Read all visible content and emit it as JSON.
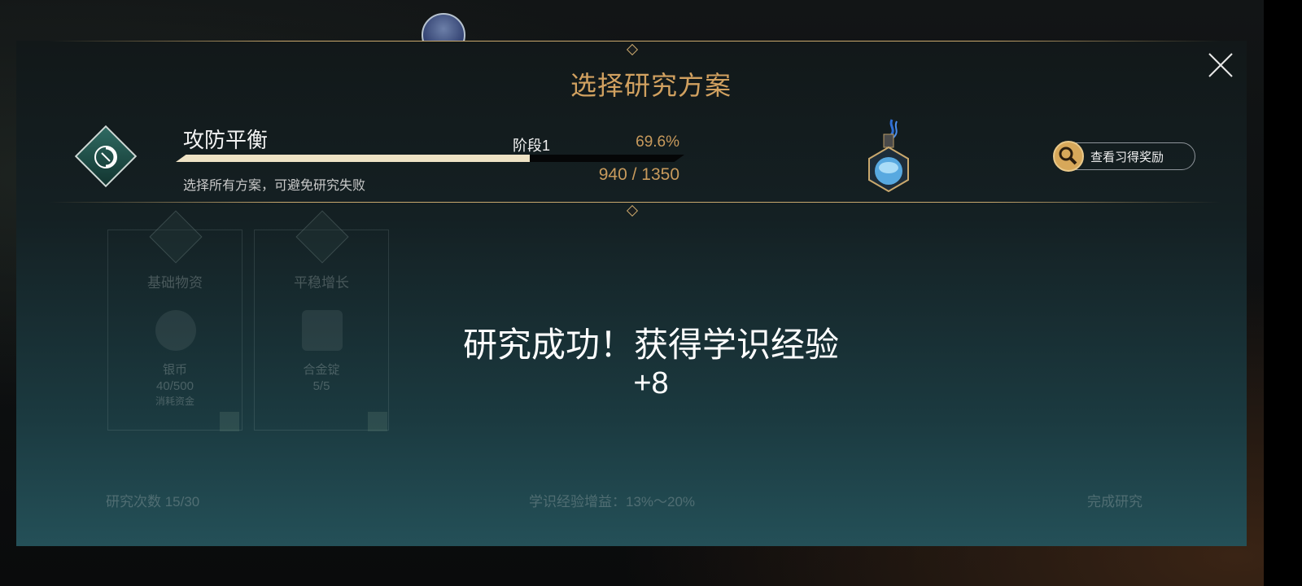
{
  "dialog": {
    "title": "选择研究方案"
  },
  "plan": {
    "name": "攻防平衡",
    "hint": "选择所有方案，可避免研究失败",
    "stage": "阶段1",
    "percent_text": "69.6%",
    "progress": 0.696,
    "xp_text": "940 / 1350"
  },
  "reward_button": {
    "label": "查看习得奖励",
    "icon": "magnifier-icon"
  },
  "options": [
    {
      "name": "基础物资",
      "resource": "银币",
      "amount": "40/500",
      "note": "消耗资金"
    },
    {
      "name": "平稳增长",
      "resource": "合金锭",
      "amount": "5/5"
    }
  ],
  "footer": {
    "left_label": "研究次数 15/30",
    "center_label": "学识经验增益：13%～20%",
    "right_label": "完成研究"
  },
  "result": {
    "message": "研究成功！获得学识经验",
    "exp_gain": "+8"
  },
  "colors": {
    "title_gold": "#d1a160",
    "value_gold": "#c89a5c",
    "progress_fill": "#efe3c5",
    "line_gold": "#c9a86d"
  }
}
